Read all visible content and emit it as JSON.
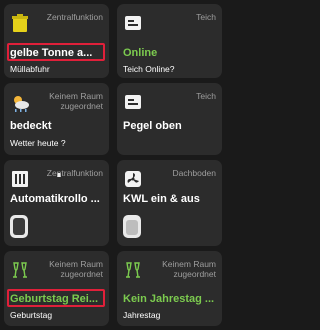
{
  "tiles": [
    {
      "label": "Zentralfunktion",
      "value": "gelbe Tonne a...",
      "sub": "Müllabfuhr",
      "icon": "yellow-bin-icon"
    },
    {
      "label": "Teich",
      "value": "Online",
      "sub": "Teich Online?",
      "icon": "display-icon"
    },
    {
      "label": "Keinem Raum zugeordnet",
      "value": "bedeckt",
      "sub": "Wetter heute ?",
      "icon": "weather-icon"
    },
    {
      "label": "Teich",
      "value": "Pegel oben",
      "sub": "",
      "icon": "display-icon"
    },
    {
      "label": "Zentralfunktion",
      "value": "Automatikrollo ...",
      "sub": "",
      "icon": "shutter-icon"
    },
    {
      "label": "Dachboden",
      "value": "KWL ein & aus",
      "sub": "",
      "icon": "fan-icon"
    },
    {
      "label": "Keinem Raum zugeordnet",
      "value": "Geburtstag Rei...",
      "sub": "Geburtstag",
      "icon": "champagne-icon"
    },
    {
      "label": "Keinem Raum zugeordnet",
      "value": "Kein Jahrestag ...",
      "sub": "Jahrestag",
      "icon": "champagne-icon"
    }
  ],
  "colors": {
    "accent_green": "#7ccb4f",
    "highlight_red": "#e0203a",
    "tile_bg": "#2c2c2c"
  }
}
